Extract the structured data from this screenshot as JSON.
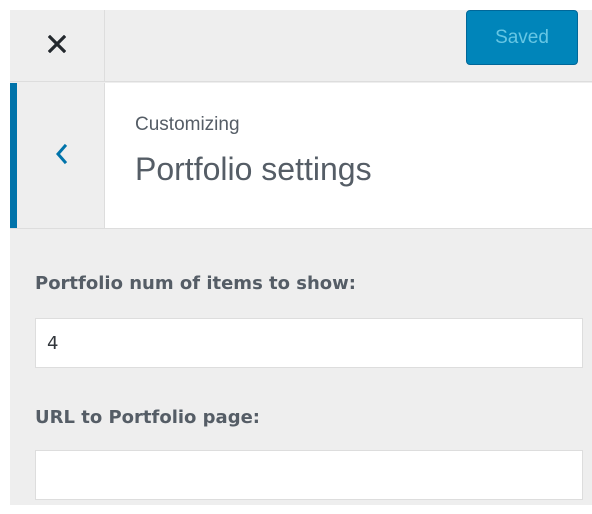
{
  "topbar": {
    "close_icon": "close-icon",
    "save_label": "Saved"
  },
  "section_header": {
    "back_icon": "chevron-left-icon",
    "breadcrumb": "Customizing",
    "title": "Portfolio settings"
  },
  "controls": {
    "num_items": {
      "label": "Portfolio num of items to show:",
      "value": "4"
    },
    "portfolio_url": {
      "label": "URL to Portfolio page:",
      "value": ""
    }
  },
  "colors": {
    "accent": "#0073aa",
    "save_button": "#0085ba",
    "panel_background": "#eeeeee"
  }
}
